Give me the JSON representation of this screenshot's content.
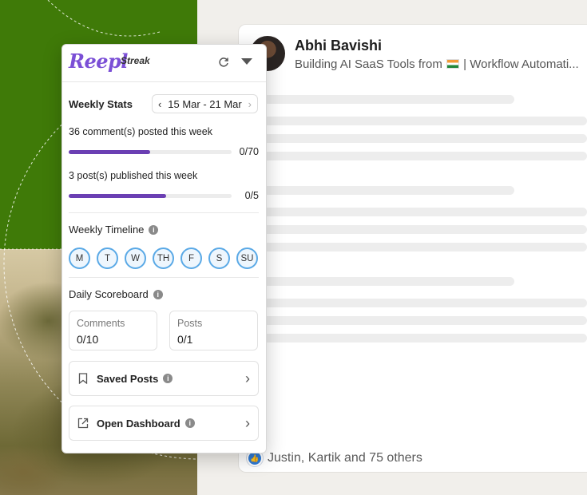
{
  "popup": {
    "brand": "Reepl",
    "product": "Streak",
    "weekly_stats": {
      "title": "Weekly Stats",
      "date_range": "15 Mar - 21 Mar",
      "comments_text": "36 comment(s) posted this week",
      "comments_count": "0/70",
      "comments_progress": 0.5,
      "posts_text": "3 post(s) published this week",
      "posts_count": "0/5",
      "posts_progress": 0.6
    },
    "timeline": {
      "title": "Weekly Timeline",
      "days": [
        "M",
        "T",
        "W",
        "TH",
        "F",
        "S",
        "SU"
      ]
    },
    "scoreboard": {
      "title": "Daily Scoreboard",
      "comments_label": "Comments",
      "comments_value": "0/10",
      "posts_label": "Posts",
      "posts_value": "0/1"
    },
    "saved_posts": "Saved Posts",
    "open_dashboard": "Open Dashboard"
  },
  "post": {
    "author": "Abhi Bavishi",
    "headline_prefix": "Building AI SaaS Tools from",
    "headline_suffix": "| Workflow Automati...",
    "reactions": "Justin, Kartik and 75 others"
  },
  "colors": {
    "brand": "#7b4fd6",
    "progress": "#6b3fb3",
    "day_ring": "#5aa9e6",
    "art_green": "#3f7a08"
  }
}
